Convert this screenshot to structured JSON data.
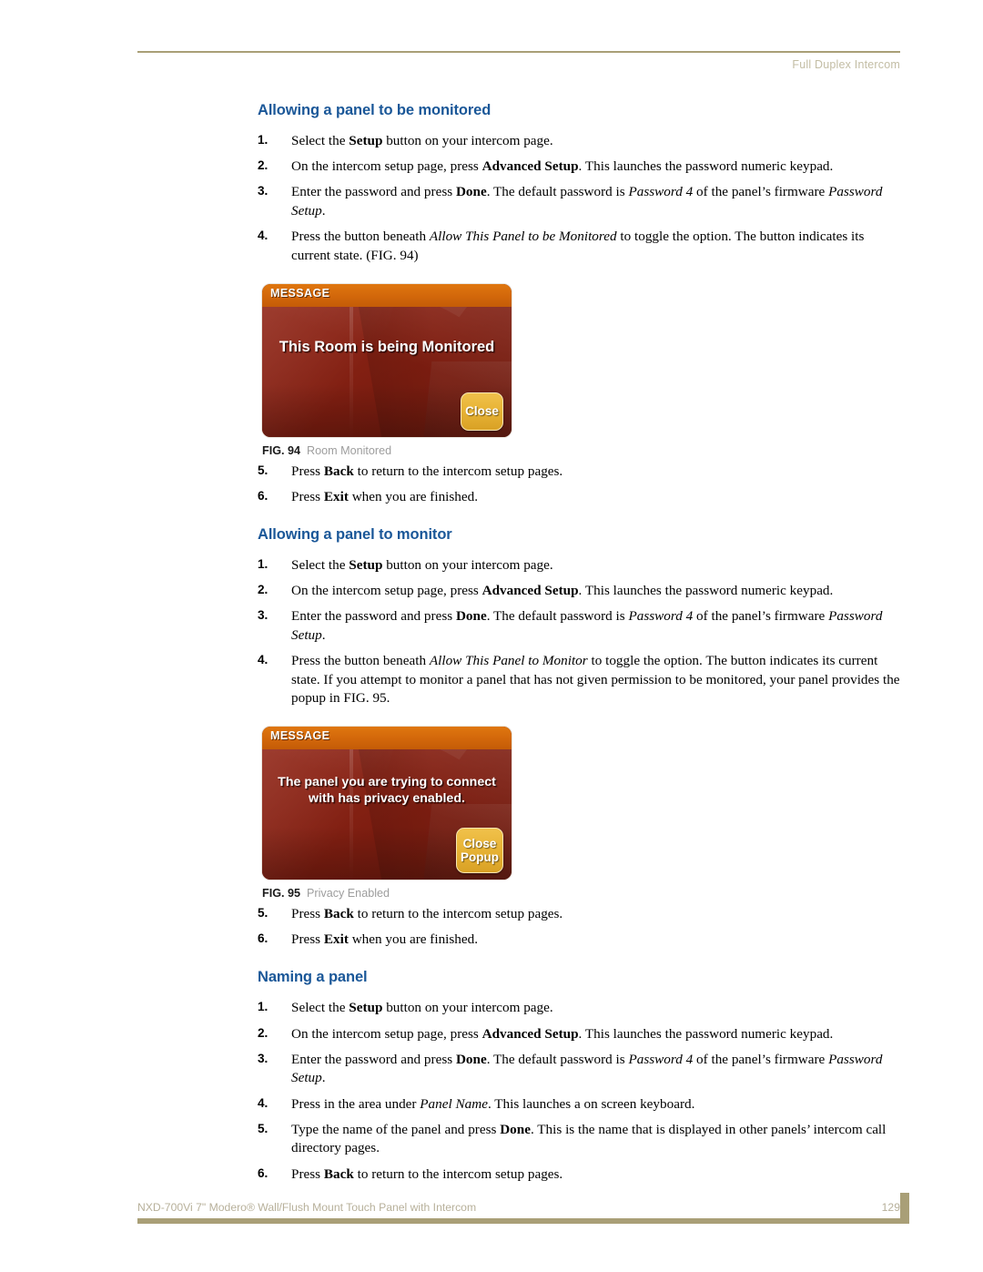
{
  "header": {
    "running_title": "Full Duplex Intercom"
  },
  "sections": [
    {
      "heading": "Allowing a panel to be monitored",
      "steps": [
        {
          "num": "1.",
          "html": "Select the <b>Setup</b> button on your intercom page."
        },
        {
          "num": "2.",
          "html": "On the intercom setup page, press <b>Advanced Setup</b>. This launches the password numeric keypad."
        },
        {
          "num": "3.",
          "html": "Enter the password and press <b>Done</b>. The default password is <i>Password 4</i> of the panel’s firmware <i>Password Setup</i>."
        },
        {
          "num": "4.",
          "html": "Press the button beneath <i>Allow This Panel to be Monitored</i> to toggle the option. The button indicates its current state. (FIG. 94)"
        }
      ]
    },
    {
      "heading": "Allowing a panel to monitor",
      "steps": [
        {
          "num": "1.",
          "html": "Select the <b>Setup</b> button on your intercom page."
        },
        {
          "num": "2.",
          "html": "On the intercom setup page, press <b>Advanced Setup</b>. This launches the password numeric keypad."
        },
        {
          "num": "3.",
          "html": "Enter the password and press <b>Done</b>. The default password is <i>Password 4</i> of the panel’s firmware <i>Password Setup</i>."
        },
        {
          "num": "4.",
          "html": "Press the button beneath <i>Allow This Panel to Monitor</i> to toggle the option. The button indicates its current state. If you attempt to monitor a panel that has not given permission to be monitored, your panel provides the popup in FIG. 95."
        }
      ]
    },
    {
      "heading": "Naming a panel",
      "steps": [
        {
          "num": "1.",
          "html": "Select the <b>Setup</b> button on your intercom page."
        },
        {
          "num": "2.",
          "html": "On the intercom setup page, press <b>Advanced Setup</b>. This launches the password numeric keypad."
        },
        {
          "num": "3.",
          "html": "Enter the password and press <b>Done</b>. The default password is <i>Password 4</i> of the panel’s firmware <i>Password Setup</i>."
        },
        {
          "num": "4.",
          "html": "Press in the area under <i>Panel Name</i>. This launches a on screen keyboard."
        },
        {
          "num": "5.",
          "html": "Type the name of the panel and press <b>Done</b>. This is the name that is displayed in other panels’ intercom call directory pages."
        },
        {
          "num": "6.",
          "html": "Press <b>Back</b> to return to the intercom setup pages."
        }
      ]
    }
  ],
  "steps_after_fig94": [
    {
      "num": "5.",
      "html": "Press <b>Back</b> to return to the intercom setup pages."
    },
    {
      "num": "6.",
      "html": "Press <b>Exit</b> when you are finished."
    }
  ],
  "steps_after_fig95": [
    {
      "num": "5.",
      "html": "Press <b>Back</b> to return to the intercom setup pages."
    },
    {
      "num": "6.",
      "html": "Press <b>Exit</b> when you are finished."
    }
  ],
  "figures": [
    {
      "id": "fig-94",
      "titlebar": "MESSAGE",
      "message": "This Room is being\nMonitored",
      "button_label": "Close",
      "caption_number": "FIG. 94",
      "caption_text": "Room Monitored",
      "colors": {
        "titlebar": "#d4690b",
        "body_dark": "#7d1d10",
        "body_light": "#93291a",
        "button": "#e8b436",
        "button_border": "#f7e6b2"
      }
    },
    {
      "id": "fig-95",
      "titlebar": "MESSAGE",
      "message": "The panel you are trying\nto connect with has\nprivacy enabled.",
      "button_label": "Close\nPopup",
      "caption_number": "FIG. 95",
      "caption_text": "Privacy Enabled",
      "colors": {
        "titlebar": "#d4690b",
        "body_dark": "#7d1d10",
        "body_light": "#93291a",
        "button": "#e8b436",
        "button_border": "#f7e6b2"
      }
    }
  ],
  "footer": {
    "left": "NXD-700Vi 7\" Modero® Wall/Flush Mount Touch Panel with Intercom",
    "page_number": "129"
  },
  "theme": {
    "heading_blue": "#1a5798",
    "rule_tan": "#a99f77",
    "header_text": "#c3bda4",
    "caption_gray": "#9d9d9d"
  }
}
